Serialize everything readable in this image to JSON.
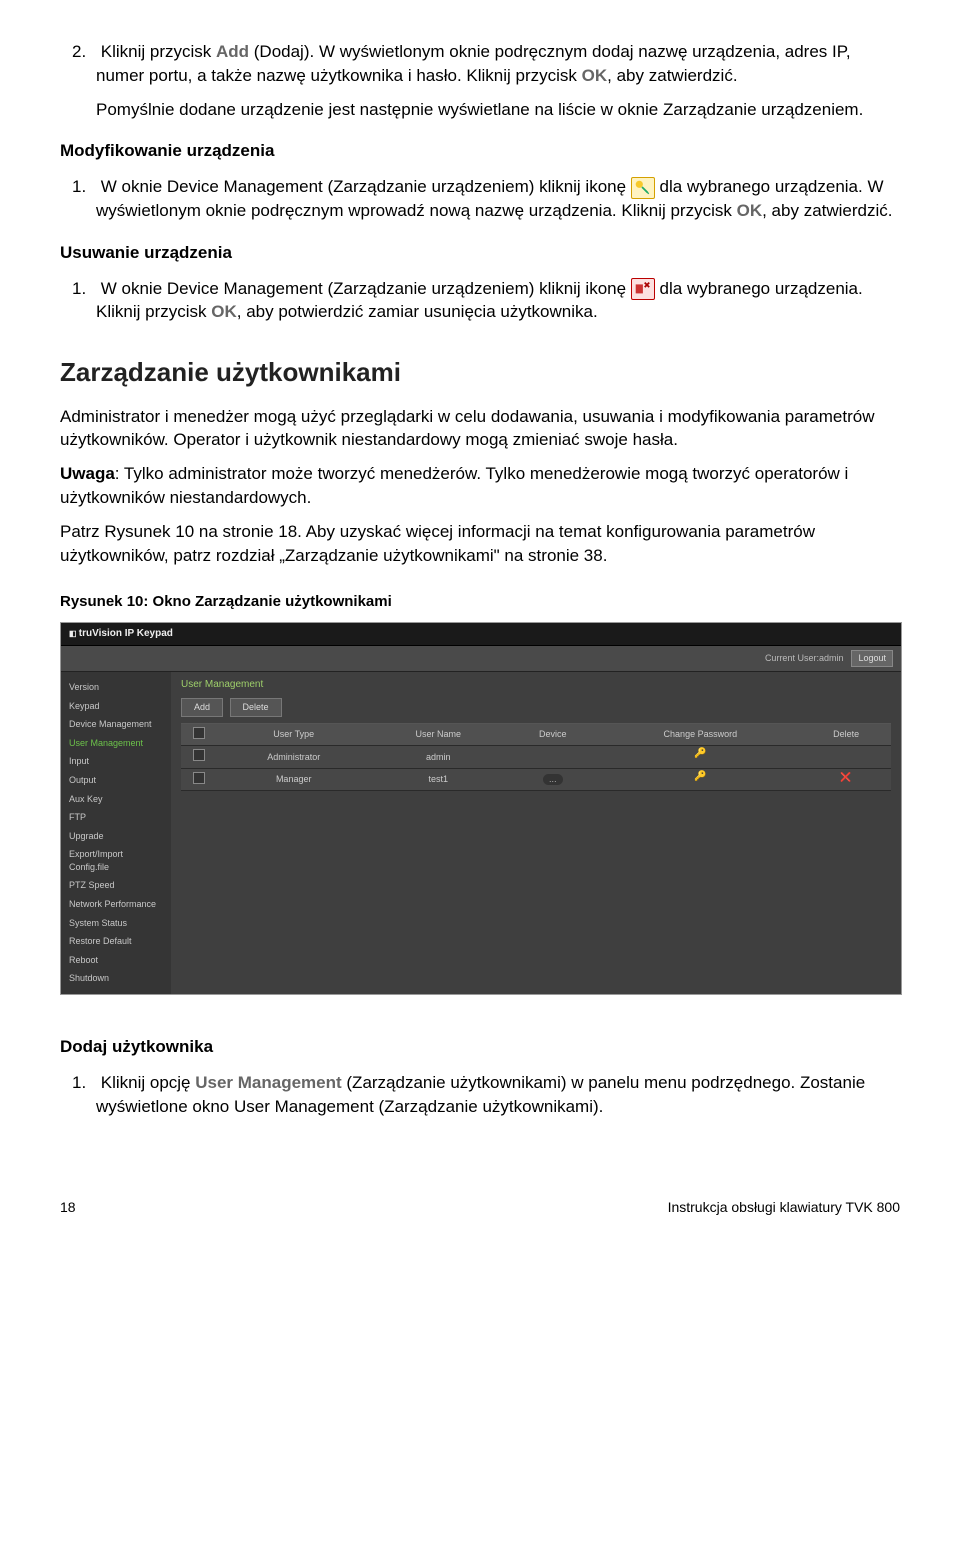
{
  "step2": {
    "num": "2.",
    "text_a": "Kliknij przycisk ",
    "bold_add": "Add",
    "text_b": " (Dodaj). W wyświetlonym oknie podręcznym dodaj nazwę urządzenia, adres IP, numer portu, a także nazwę użytkownika i hasło. Kliknij przycisk ",
    "bold_ok": "OK",
    "text_c": ", aby zatwierdzić.",
    "para2": "Pomyślnie dodane urządzenie jest następnie wyświetlane na liście w oknie Zarządzanie urządzeniem."
  },
  "mod": {
    "heading": "Modyfikowanie urządzenia",
    "num": "1.",
    "text_a": "W oknie Device Management (Zarządzanie urządzeniem) kliknij ikonę ",
    "text_b": " dla wybranego urządzenia. W wyświetlonym oknie podręcznym wprowadź nową nazwę urządzenia. Kliknij przycisk ",
    "bold_ok": "OK",
    "text_c": ", aby zatwierdzić."
  },
  "del": {
    "heading": "Usuwanie urządzenia",
    "num": "1.",
    "text_a": "W oknie Device Management (Zarządzanie urządzeniem) kliknij ikonę ",
    "text_b": " dla wybranego urządzenia. Kliknij przycisk ",
    "bold_ok": "OK",
    "text_c": ", aby potwierdzić zamiar usunięcia użytkownika."
  },
  "users": {
    "heading": "Zarządzanie użytkownikami",
    "p1": "Administrator i menedżer mogą użyć przeglądarki w celu dodawania, usuwania i modyfikowania parametrów użytkowników. Operator i użytkownik niestandardowy mogą zmieniać swoje hasła.",
    "p2_bold": "Uwaga",
    "p2_rest": ": Tylko administrator może tworzyć menedżerów. Tylko menedżerowie mogą tworzyć operatorów i użytkowników niestandardowych.",
    "p3": "Patrz Rysunek 10 na stronie 18. Aby uzyskać więcej informacji na temat konfigurowania parametrów użytkowników, patrz rozdział „Zarządzanie użytkownikami\" na stronie 38."
  },
  "fig": {
    "caption": "Rysunek 10: Okno Zarządzanie użytkownikami"
  },
  "app": {
    "logo": "truVision IP Keypad",
    "current_user_label": "Current User:admin",
    "logout": "Logout",
    "sidebar": [
      "Version",
      "Keypad",
      "Device Management",
      "User Management",
      "Input",
      "Output",
      "Aux Key",
      "FTP",
      "Upgrade",
      "Export/Import Config.file",
      "PTZ Speed",
      "Network Performance",
      "System Status",
      "Restore Default",
      "Reboot",
      "Shutdown"
    ],
    "section_title": "User Management",
    "btn_add": "Add",
    "btn_delete": "Delete",
    "headers": {
      "chk": "",
      "type": "User Type",
      "name": "User Name",
      "device": "Device",
      "pw": "Change Password",
      "del": "Delete"
    },
    "rows": [
      {
        "type": "Administrator",
        "name": "admin",
        "device": ""
      },
      {
        "type": "Manager",
        "name": "test1",
        "device": "…"
      }
    ]
  },
  "adduser": {
    "heading": "Dodaj użytkownika",
    "num": "1.",
    "text_a": "Kliknij opcję ",
    "bold": "User Management",
    "text_b": " (Zarządzanie użytkownikami) w panelu menu podrzędnego. Zostanie wyświetlone okno User Management (Zarządzanie użytkownikami)."
  },
  "footer": {
    "page": "18",
    "title": "Instrukcja obsługi klawiatury TVK 800"
  }
}
